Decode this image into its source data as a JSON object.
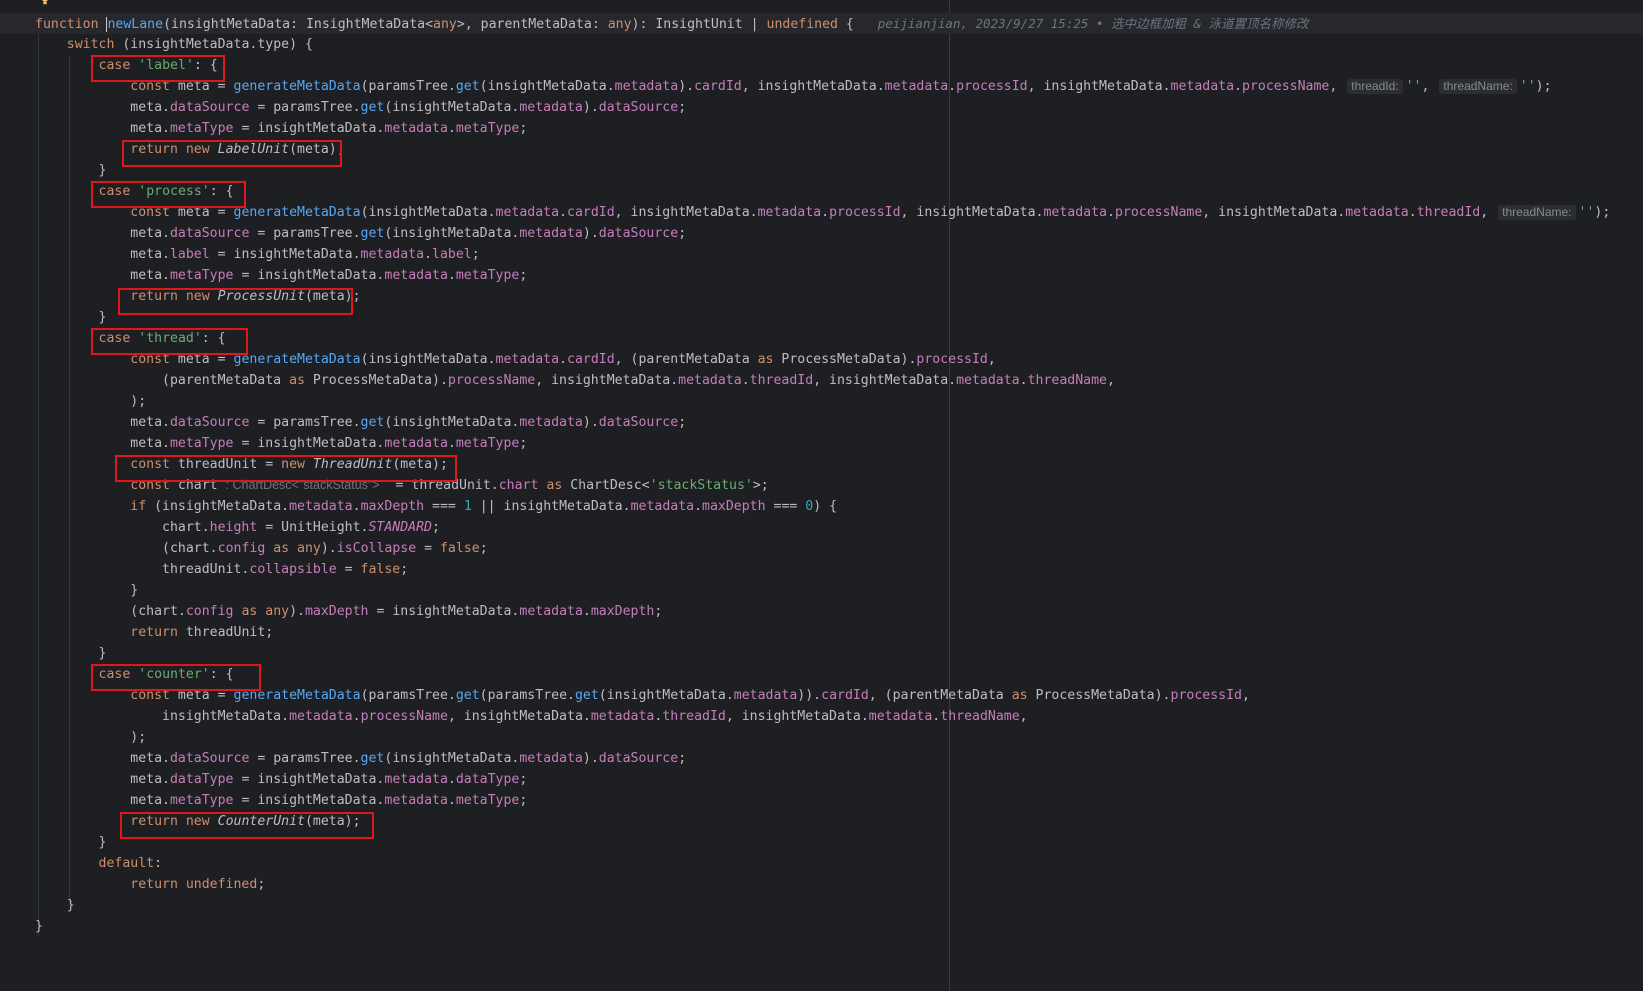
{
  "editor": {
    "blame": "peijianjian, 2023/9/27 15:25 • 选中边框加粗 & 泳道置顶名称修改",
    "hints": {
      "threadId": "threadId:",
      "threadName": "threadName:",
      "chart_type": ": ChartDesc<\"stackStatus\">"
    }
  }
}
